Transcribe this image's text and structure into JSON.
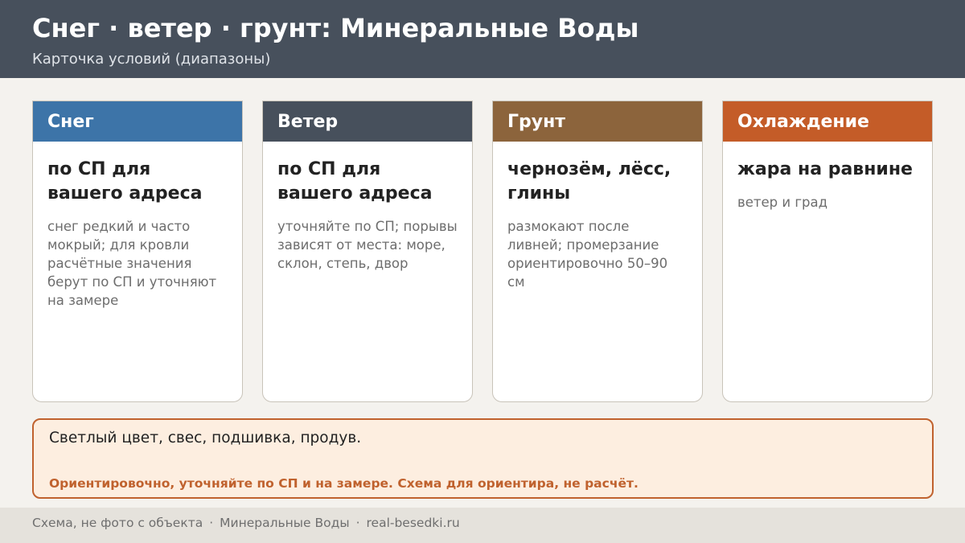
{
  "header": {
    "title": "Снег · ветер · грунт: Минеральные Воды",
    "subtitle": "Карточка условий (диапазоны)"
  },
  "cards": [
    {
      "title": "Снег",
      "value": "по СП для вашего адреса",
      "description": "снег редкий и часто мокрый; для кровли расчётные значения берут по СП и уточняют на замере",
      "color": "#3d74a8"
    },
    {
      "title": "Ветер",
      "value": "по СП для вашего адреса",
      "description": "уточняйте по СП; порывы зависят от места: море, склон, степь, двор",
      "color": "#47505c"
    },
    {
      "title": "Грунт",
      "value": "чернозём, лёсс, глины",
      "description": "размокают после ливней; промерзание ориентировочно 50–90 см",
      "color": "#8c643c"
    },
    {
      "title": "Охлаждение",
      "value": "жара на равнине",
      "description": "ветер и град",
      "color": "#c45c28"
    }
  ],
  "note": {
    "text": "Светлый цвет, свес, подшивка, продув.",
    "warning": "Ориентировочно, уточняйте по СП и на замере. Схема для ориентира, не расчёт."
  },
  "footer": {
    "part1": "Схема, не фото с объекта",
    "separator": "·",
    "part2": "Минеральные Воды",
    "part3": "real-besedki.ru"
  }
}
